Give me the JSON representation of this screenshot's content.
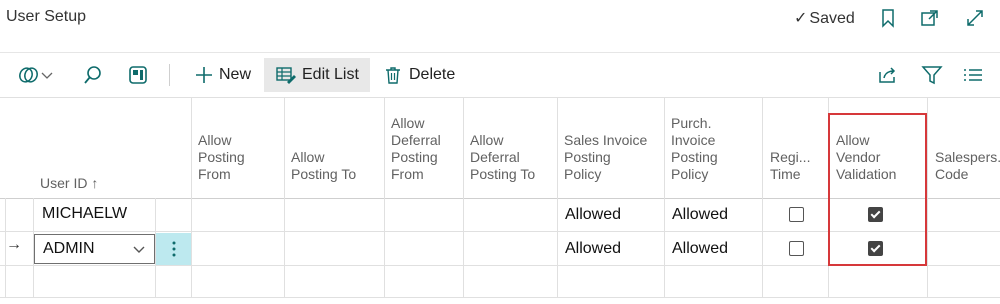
{
  "header": {
    "title": "User Setup",
    "saved_status": "Saved"
  },
  "toolbar": {
    "new_label": "New",
    "edit_list_label": "Edit List",
    "delete_label": "Delete"
  },
  "columns": [
    {
      "line1": "",
      "line2": "",
      "line3": "",
      "line4": "User ID ↑"
    },
    {
      "line1": "",
      "line2": "Allow",
      "line3": "Posting",
      "line4": "From"
    },
    {
      "line1": "",
      "line2": "",
      "line3": "Allow",
      "line4": "Posting To"
    },
    {
      "line1": "Allow",
      "line2": "Deferral",
      "line3": "Posting",
      "line4": "From"
    },
    {
      "line1": "",
      "line2": "Allow",
      "line3": "Deferral",
      "line4": "Posting To"
    },
    {
      "line1": "",
      "line2": "Sales Invoice",
      "line3": "Posting",
      "line4": "Policy"
    },
    {
      "line1": "Purch.",
      "line2": "Invoice",
      "line3": "Posting",
      "line4": "Policy"
    },
    {
      "line1": "",
      "line2": "",
      "line3": "Regi...",
      "line4": "Time"
    },
    {
      "line1": "",
      "line2": "Allow",
      "line3": "Vendor",
      "line4": "Validation"
    },
    {
      "line1": "",
      "line2": "",
      "line3": "Salespers.",
      "line4": "Code"
    }
  ],
  "rows": [
    {
      "user_id": "MICHAELW",
      "sales_invoice_posting_policy": "Allowed",
      "purch_invoice_posting_policy": "Allowed",
      "register_time": false,
      "allow_vendor_validation": true
    },
    {
      "user_id": "ADMIN",
      "sales_invoice_posting_policy": "Allowed",
      "purch_invoice_posting_policy": "Allowed",
      "register_time": false,
      "allow_vendor_validation": true
    }
  ]
}
